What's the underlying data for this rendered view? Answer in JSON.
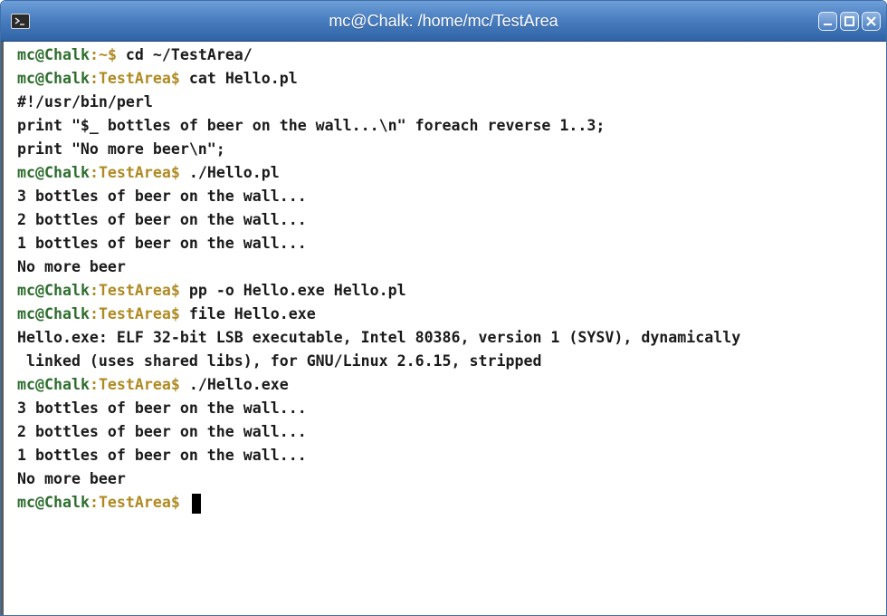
{
  "window": {
    "title": "mc@Chalk: /home/mc/TestArea"
  },
  "prompt": {
    "user": "mc",
    "at": "@",
    "host": "Chalk",
    "colon": ":",
    "symbol": "$ "
  },
  "lines": [
    {
      "type": "prompt",
      "path": "~",
      "command": "cd ~/TestArea/"
    },
    {
      "type": "prompt",
      "path": "TestArea",
      "command": "cat Hello.pl"
    },
    {
      "type": "output",
      "text": "#!/usr/bin/perl"
    },
    {
      "type": "output",
      "text": "print \"$_ bottles of beer on the wall...\\n\" foreach reverse 1..3;"
    },
    {
      "type": "output",
      "text": "print \"No more beer\\n\";"
    },
    {
      "type": "prompt",
      "path": "TestArea",
      "command": "./Hello.pl"
    },
    {
      "type": "output",
      "text": "3 bottles of beer on the wall..."
    },
    {
      "type": "output",
      "text": "2 bottles of beer on the wall..."
    },
    {
      "type": "output",
      "text": "1 bottles of beer on the wall..."
    },
    {
      "type": "output",
      "text": "No more beer"
    },
    {
      "type": "prompt",
      "path": "TestArea",
      "command": "pp -o Hello.exe Hello.pl"
    },
    {
      "type": "prompt",
      "path": "TestArea",
      "command": "file Hello.exe"
    },
    {
      "type": "output",
      "text": "Hello.exe: ELF 32-bit LSB executable, Intel 80386, version 1 (SYSV), dynamically"
    },
    {
      "type": "output",
      "text": " linked (uses shared libs), for GNU/Linux 2.6.15, stripped"
    },
    {
      "type": "prompt",
      "path": "TestArea",
      "command": "./Hello.exe"
    },
    {
      "type": "output",
      "text": "3 bottles of beer on the wall..."
    },
    {
      "type": "output",
      "text": "2 bottles of beer on the wall..."
    },
    {
      "type": "output",
      "text": "1 bottles of beer on the wall..."
    },
    {
      "type": "output",
      "text": "No more beer"
    },
    {
      "type": "prompt",
      "path": "TestArea",
      "command": "",
      "cursor": true
    }
  ],
  "colors": {
    "titlebar": "#4a7fc1",
    "prompt_user_host": "#2d6e2d",
    "prompt_path": "#b08a23",
    "text": "#1a1a1a",
    "background": "#ffffff"
  },
  "icons": {
    "app": "terminal-icon",
    "minimize": "minimize-icon",
    "maximize": "maximize-icon",
    "close": "close-icon"
  }
}
